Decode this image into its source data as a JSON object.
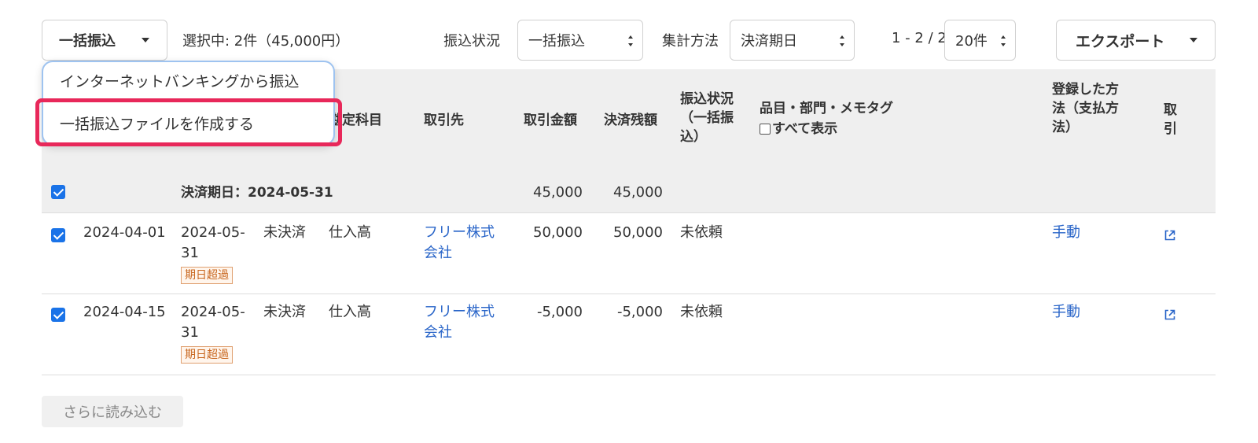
{
  "toolbar": {
    "bulk_button_label": "一括振込",
    "selection_summary": "選択中: 2件（45,000円）",
    "transfer_status_label": "振込状況",
    "transfer_status_value": "一括振込",
    "aggregate_label": "集計方法",
    "aggregate_value": "決済期日",
    "pagination": "1 - 2 / 2",
    "per_page_value": "20件",
    "export_label": "エクスポート"
  },
  "dropdown": {
    "items": [
      {
        "label": "インターネットバンキングから振込"
      },
      {
        "label": "一括振込ファイルを作成する"
      }
    ]
  },
  "table": {
    "headers": {
      "account": "勘定科目",
      "partner": "取引先",
      "amount": "取引金額",
      "balance": "決済残額",
      "transfer_status": "振込状況（一括振込）",
      "tags": "品目・部門・メモタグ",
      "show_all": "すべて表示",
      "registered_method": "登録した方法（支払方法）",
      "deal": "取引"
    },
    "group": {
      "label": "決済期日：2024-05-31",
      "amount": "45,000",
      "balance": "45,000"
    },
    "rows": [
      {
        "date": "2024-04-01",
        "due_line1": "2024-05-",
        "due_line2": "31",
        "overdue": "期日超過",
        "status": "未決済",
        "account": "仕入高",
        "partner_line1": "フリー株式",
        "partner_line2": "会社",
        "amount": "50,000",
        "balance": "50,000",
        "transfer_status": "未依頼",
        "method": "手動"
      },
      {
        "date": "2024-04-15",
        "due_line1": "2024-05-",
        "due_line2": "31",
        "overdue": "期日超過",
        "status": "未決済",
        "account": "仕入高",
        "partner_line1": "フリー株式",
        "partner_line2": "会社",
        "amount": "-5,000",
        "balance": "-5,000",
        "transfer_status": "未依頼",
        "method": "手動"
      }
    ]
  },
  "load_more_label": "さらに読み込む",
  "colors": {
    "accent": "#1a73e8",
    "link": "#2864c8",
    "highlight": "#e8285a",
    "overdue": "#c8661e"
  }
}
